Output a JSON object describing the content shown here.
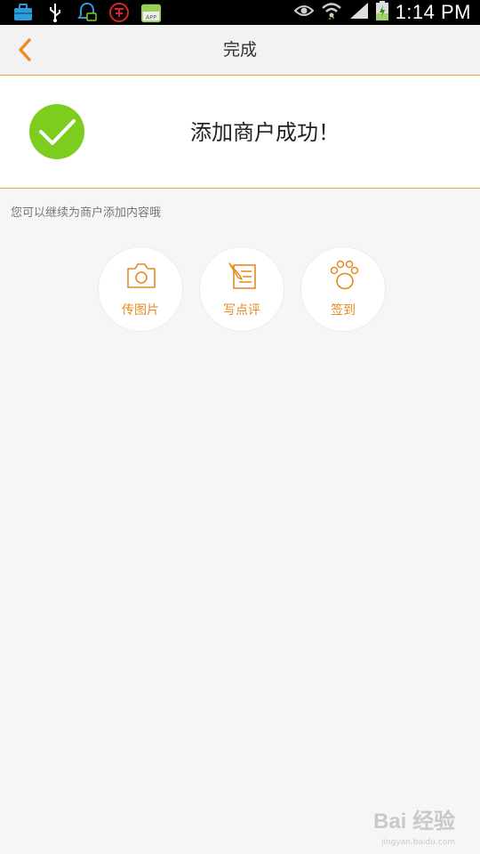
{
  "status_bar": {
    "time": "1:14 PM",
    "left_icons": [
      "briefcase-icon",
      "usb-icon",
      "notification-icon",
      "stamp-icon",
      "app-icon"
    ],
    "app_icon_label": "APP",
    "right_icons": [
      "eye-icon",
      "wifi-icon",
      "signal-icon",
      "battery-icon"
    ]
  },
  "header": {
    "title": "完成",
    "back_icon": "chevron-left-icon",
    "accent": "#f08c22"
  },
  "success": {
    "message": "添加商户成功！",
    "icon": "check-circle-icon",
    "icon_color": "#7ccd1e"
  },
  "hint": "您可以继续为商户添加内容哦",
  "actions": [
    {
      "label": "传图片",
      "icon": "camera-icon"
    },
    {
      "label": "写点评",
      "icon": "edit-note-icon"
    },
    {
      "label": "签到",
      "icon": "paw-icon"
    }
  ],
  "watermark": {
    "logo": "Bai 经验",
    "url": "jingyan.baidu.com"
  }
}
